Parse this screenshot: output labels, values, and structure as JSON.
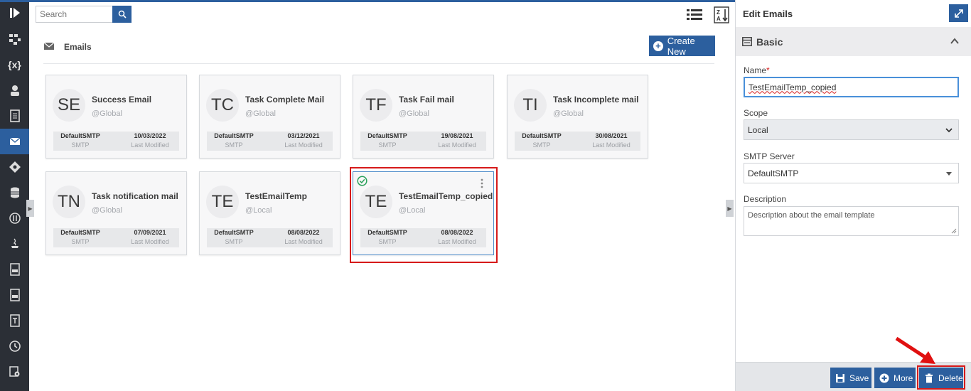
{
  "rail": {
    "items": [
      {
        "icon": "play-panel-icon"
      },
      {
        "icon": "workflow-icon"
      },
      {
        "icon": "variables-icon",
        "text": "{x}"
      },
      {
        "icon": "user-icon"
      },
      {
        "icon": "document-icon"
      },
      {
        "icon": "email-icon",
        "active": true
      },
      {
        "icon": "diamond-icon"
      },
      {
        "icon": "database-icon"
      },
      {
        "icon": "code-circle-icon"
      },
      {
        "icon": "java-icon"
      },
      {
        "icon": "file-type-icon"
      },
      {
        "icon": "file-type-2-icon"
      },
      {
        "icon": "text-file-icon"
      },
      {
        "icon": "clock-icon"
      },
      {
        "icon": "settings-doc-icon"
      }
    ]
  },
  "toolbar": {
    "search_placeholder": "Search"
  },
  "section": {
    "title": "Emails",
    "create_label": "Create New"
  },
  "cards": [
    {
      "initials": "SE",
      "name": "Success Email",
      "scope": "@Global",
      "smtp": "DefaultSMTP",
      "smtp_sub": "SMTP",
      "date": "10/03/2022",
      "date_sub": "Last Modified"
    },
    {
      "initials": "TC",
      "name": "Task Complete Mail",
      "scope": "@Global",
      "smtp": "DefaultSMTP",
      "smtp_sub": "SMTP",
      "date": "03/12/2021",
      "date_sub": "Last Modified"
    },
    {
      "initials": "TF",
      "name": "Task Fail mail",
      "scope": "@Global",
      "smtp": "DefaultSMTP",
      "smtp_sub": "SMTP",
      "date": "19/08/2021",
      "date_sub": "Last Modified"
    },
    {
      "initials": "TI",
      "name": "Task Incomplete mail",
      "scope": "@Global",
      "smtp": "DefaultSMTP",
      "smtp_sub": "SMTP",
      "date": "30/08/2021",
      "date_sub": "Last Modified"
    },
    {
      "initials": "TN",
      "name": "Task notification mail",
      "scope": "@Global",
      "smtp": "DefaultSMTP",
      "smtp_sub": "SMTP",
      "date": "07/09/2021",
      "date_sub": "Last Modified"
    },
    {
      "initials": "TE",
      "name": "TestEmailTemp",
      "scope": "@Local",
      "smtp": "DefaultSMTP",
      "smtp_sub": "SMTP",
      "date": "08/08/2022",
      "date_sub": "Last Modified"
    },
    {
      "initials": "TE",
      "name": "TestEmailTemp_copied",
      "scope": "@Local",
      "smtp": "DefaultSMTP",
      "smtp_sub": "SMTP",
      "date": "08/08/2022",
      "date_sub": "Last Modified",
      "selected": true
    }
  ],
  "panel": {
    "title": "Edit Emails",
    "section_title": "Basic",
    "name_label": "Name",
    "name_required": "*",
    "name_value": "TestEmailTemp_copied",
    "scope_label": "Scope",
    "scope_value": "Local",
    "smtp_label": "SMTP Server",
    "smtp_value": "DefaultSMTP",
    "description_label": "Description",
    "description_value": "Description about the email template",
    "save_label": "Save",
    "more_label": "More",
    "delete_label": "Delete"
  },
  "colors": {
    "accent": "#2c5f9e",
    "rail_bg": "#2b2f36",
    "highlight": "#d61a1a"
  }
}
